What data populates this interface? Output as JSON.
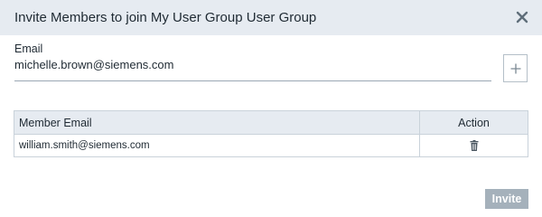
{
  "dialog": {
    "title": "Invite Members to join My User Group User Group",
    "close_icon": "close-icon"
  },
  "form": {
    "email_label": "Email",
    "email_value": "michelle.brown@siemens.com",
    "add_icon": "plus-icon"
  },
  "table": {
    "columns": [
      "Member Email",
      "Action"
    ],
    "rows": [
      {
        "email": "william.smith@siemens.com",
        "action_icon": "trash-icon"
      }
    ]
  },
  "footer": {
    "invite_label": "Invite",
    "invite_disabled": true
  },
  "colors": {
    "header_bg": "#e6ebf1",
    "border": "#c9d2da",
    "button_disabled_bg": "#a5b1bb",
    "text": "#1f2a33"
  }
}
